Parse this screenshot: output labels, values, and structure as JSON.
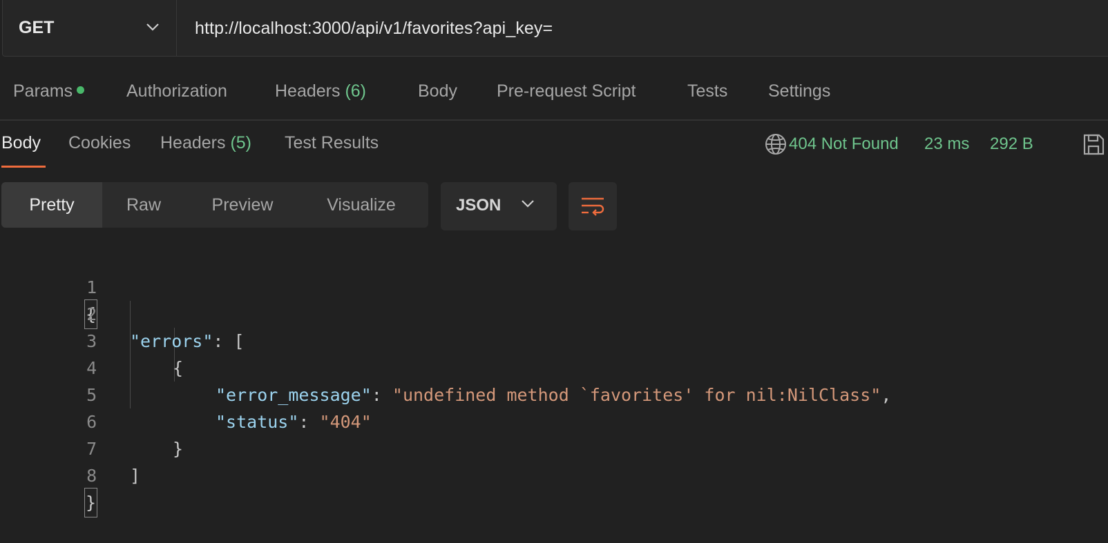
{
  "request": {
    "method": "GET",
    "url": "http://localhost:3000/api/v1/favorites?api_key="
  },
  "request_tabs": [
    {
      "label": "Params",
      "indicator": "dot"
    },
    {
      "label": "Authorization"
    },
    {
      "label": "Headers",
      "count": "(6)"
    },
    {
      "label": "Body"
    },
    {
      "label": "Pre-request Script"
    },
    {
      "label": "Tests"
    },
    {
      "label": "Settings"
    }
  ],
  "response_tabs": [
    {
      "label": "Body",
      "active": true
    },
    {
      "label": "Cookies"
    },
    {
      "label": "Headers",
      "count": "(5)"
    },
    {
      "label": "Test Results"
    }
  ],
  "response_status": {
    "status": "404 Not Found",
    "time": "23 ms",
    "size": "292 B",
    "color": "#6fc58d",
    "icons": [
      "globe-icon",
      "save-icon"
    ]
  },
  "view_modes": [
    "Pretty",
    "Raw",
    "Preview",
    "Visualize"
  ],
  "active_view": "Pretty",
  "format": "JSON",
  "wrap_icon": "wrap-lines-icon",
  "code": {
    "line_numbers": [
      "1",
      "2",
      "3",
      "4",
      "5",
      "6",
      "7",
      "8"
    ],
    "l1": "{",
    "l2_key": "\"errors\"",
    "l2_rest": ": [",
    "l3": "{",
    "l4_key": "\"error_message\"",
    "l4_colon": ": ",
    "l4_val": "\"undefined method `favorites' for nil:NilClass\"",
    "l4_comma": ",",
    "l5_key": "\"status\"",
    "l5_colon": ": ",
    "l5_val": "\"404\"",
    "l6": "}",
    "l7": "]",
    "l8": "}"
  },
  "colors": {
    "accent": "#ef6c3d",
    "success": "#6fc58d",
    "json_key": "#9cd3ee",
    "json_string": "#d4987a"
  }
}
